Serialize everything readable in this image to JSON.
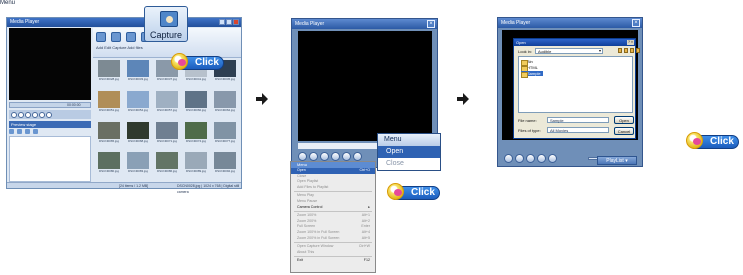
{
  "step1": {
    "window_title": "Media Player",
    "toolbar_labels": "Add  Edit Capture  Add files",
    "seek_time": "00:00:00",
    "panel_title": "Preview stage",
    "thumbnails": [
      {
        "caption": "DSCN0028.jpg",
        "color": "#7d8a93"
      },
      {
        "caption": "DSCN0033.jpg",
        "color": "#5d86b8"
      },
      {
        "caption": "DSCN0037.jpg",
        "color": "#8a99a9"
      },
      {
        "caption": "DSCN0041.jpg",
        "color": "#b7c1cc"
      },
      {
        "caption": "DSCN0045.jpg",
        "color": "#2e3f52"
      },
      {
        "caption": "DSCN0051.jpg",
        "color": "#b08e58"
      },
      {
        "caption": "DSCN0054.jpg",
        "color": "#8aa9cf"
      },
      {
        "caption": "DSCN0057.jpg",
        "color": "#9fb0c2"
      },
      {
        "caption": "DSCN0060.jpg",
        "color": "#5f7387"
      },
      {
        "caption": "DSCN0062.jpg",
        "color": "#8898ab"
      },
      {
        "caption": "DSCN0065.jpg",
        "color": "#6a6f63"
      },
      {
        "caption": "DSCN0068.jpg",
        "color": "#2f3a2e"
      },
      {
        "caption": "DSCN0071.jpg",
        "color": "#6f7f91"
      },
      {
        "caption": "DSCN0074.jpg",
        "color": "#4f6c4a"
      },
      {
        "caption": "DSCN0077.jpg",
        "color": "#8093a5"
      },
      {
        "caption": "DSCN0080.jpg",
        "color": "#5c6f60"
      },
      {
        "caption": "DSCN0083.jpg",
        "color": "#8aa0b6"
      },
      {
        "caption": "DSCN0086.jpg",
        "color": "#637566"
      },
      {
        "caption": "DSCN0089.jpg",
        "color": "#9aa9b8"
      },
      {
        "caption": "DSCN0092.jpg",
        "color": "#778898"
      }
    ],
    "status_left": "[24 items / 1.2 MB]",
    "status_right": "DSCN0028.jpg  | 1024 x 768 | Digital still camera"
  },
  "capture_callout": {
    "label": "Capture"
  },
  "click_label": "Click",
  "step2": {
    "window_title": "Media Player",
    "time": "00:00:00",
    "popup": {
      "header": "Menu",
      "open": "Open",
      "close": "Close"
    },
    "menu_list": {
      "header": "Menu",
      "items": [
        {
          "label": "Open",
          "shortcut": "Ctrl+O",
          "state": "sel"
        },
        {
          "label": "Close",
          "shortcut": "",
          "state": "off"
        },
        {
          "label": "Open Playlist",
          "shortcut": "",
          "state": "off"
        },
        {
          "label": "Add Files to Playlist",
          "shortcut": "",
          "state": "off"
        },
        {
          "label": "sep"
        },
        {
          "label": "Menu Play",
          "shortcut": "",
          "state": "off"
        },
        {
          "label": "Menu Pause",
          "shortcut": "",
          "state": "off"
        },
        {
          "label": "Camera Control",
          "shortcut": "▸",
          "state": "on"
        },
        {
          "label": "sep"
        },
        {
          "label": "Zoom 100%",
          "shortcut": "Alt+1",
          "state": "off"
        },
        {
          "label": "Zoom 200%",
          "shortcut": "Alt+2",
          "state": "off"
        },
        {
          "label": "Full Screen",
          "shortcut": "Enter",
          "state": "off"
        },
        {
          "label": "Zoom 100% in Full Screen",
          "shortcut": "Alt+4",
          "state": "off"
        },
        {
          "label": "Zoom 200% in Full Screen",
          "shortcut": "Alt+5",
          "state": "off"
        },
        {
          "label": "sep"
        },
        {
          "label": "Open Capture Window",
          "shortcut": "Ctrl+W",
          "state": "off"
        },
        {
          "label": "About This",
          "shortcut": "",
          "state": "off"
        },
        {
          "label": "sep"
        },
        {
          "label": "Exit",
          "shortcut": "F12",
          "state": "on"
        }
      ]
    }
  },
  "step3": {
    "window_title": "Media Player",
    "menu_button": "Menu",
    "playlist_button": "PlayList ▾",
    "dialog": {
      "title": "Open",
      "title_buttons": "? ×",
      "look_in_label": "Look in:",
      "look_in_value": "Audible",
      "files": [
        "Bin",
        "HTML",
        "Sample"
      ],
      "file_name_label": "File name:",
      "file_name_value": "Sample",
      "files_of_type_label": "Files of type:",
      "files_of_type_value": "All Movies",
      "open_button": "Open",
      "cancel_button": "Cancel"
    }
  },
  "colors": {
    "accent": "#2e62b3",
    "arrow": "#1a1a1a",
    "click_badge": "#1c5dbd"
  }
}
